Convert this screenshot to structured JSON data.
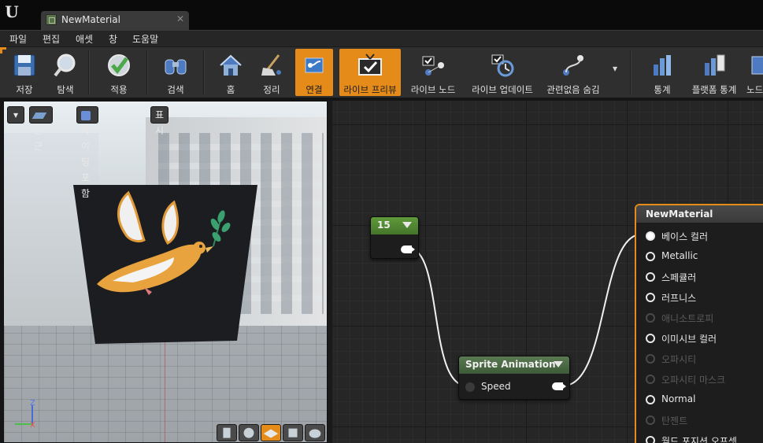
{
  "window": {
    "logo": "U",
    "tab_title": "NewMaterial",
    "tab_close": "✕"
  },
  "menu": [
    "파일",
    "편집",
    "애셋",
    "창",
    "도움말"
  ],
  "toolbar": {
    "buttons": [
      {
        "label": "저장",
        "icon": "save-icon"
      },
      {
        "label": "탐색",
        "icon": "browse-icon"
      },
      {
        "label": "적용",
        "icon": "apply-icon"
      },
      {
        "label": "검색",
        "icon": "search-icon"
      },
      {
        "label": "홈",
        "icon": "home-icon"
      },
      {
        "label": "정리",
        "icon": "clean-up-icon"
      },
      {
        "label": "연결",
        "icon": "connectors-icon",
        "active": true
      },
      {
        "label": "라이브 프리뷰",
        "icon": "live-preview-icon",
        "active": true
      },
      {
        "label": "라이브 노드",
        "icon": "live-nodes-icon"
      },
      {
        "label": "라이브 업데이트",
        "icon": "live-update-icon"
      },
      {
        "label": "관련없음 숨김",
        "icon": "hide-unrelated-icon"
      },
      {
        "label": "통계",
        "icon": "stats-icon"
      },
      {
        "label": "플랫폼 통계",
        "icon": "platform-stats-icon"
      },
      {
        "label": "노드",
        "icon": "nodes-icon"
      }
    ],
    "dropdown": "▾"
  },
  "viewport": {
    "dropdown": "▾",
    "perspective_label": "원근",
    "lighting_label": "라이팅포함",
    "show_label": "표시",
    "axis_z": "Z",
    "axis_x": "X",
    "colors": {
      "accent": "#e48b1a"
    }
  },
  "graph": {
    "constant_node": {
      "value": "15"
    },
    "sprite_node": {
      "title": "Sprite Animation",
      "input": "Speed"
    },
    "material_node": {
      "title": "NewMaterial",
      "pins": [
        {
          "label": "베이스 컬러",
          "state": "connected"
        },
        {
          "label": "Metallic",
          "state": "enabled"
        },
        {
          "label": "스페큘러",
          "state": "enabled"
        },
        {
          "label": "러프니스",
          "state": "enabled"
        },
        {
          "label": "애니소트로피",
          "state": "disabled"
        },
        {
          "label": "이미시브 컬러",
          "state": "enabled"
        },
        {
          "label": "오파시티",
          "state": "disabled"
        },
        {
          "label": "오파시티 마스크",
          "state": "disabled"
        },
        {
          "label": "Normal",
          "state": "enabled"
        },
        {
          "label": "탄젠트",
          "state": "disabled"
        },
        {
          "label": "월드 포지션 오프셋",
          "state": "enabled"
        }
      ]
    }
  }
}
